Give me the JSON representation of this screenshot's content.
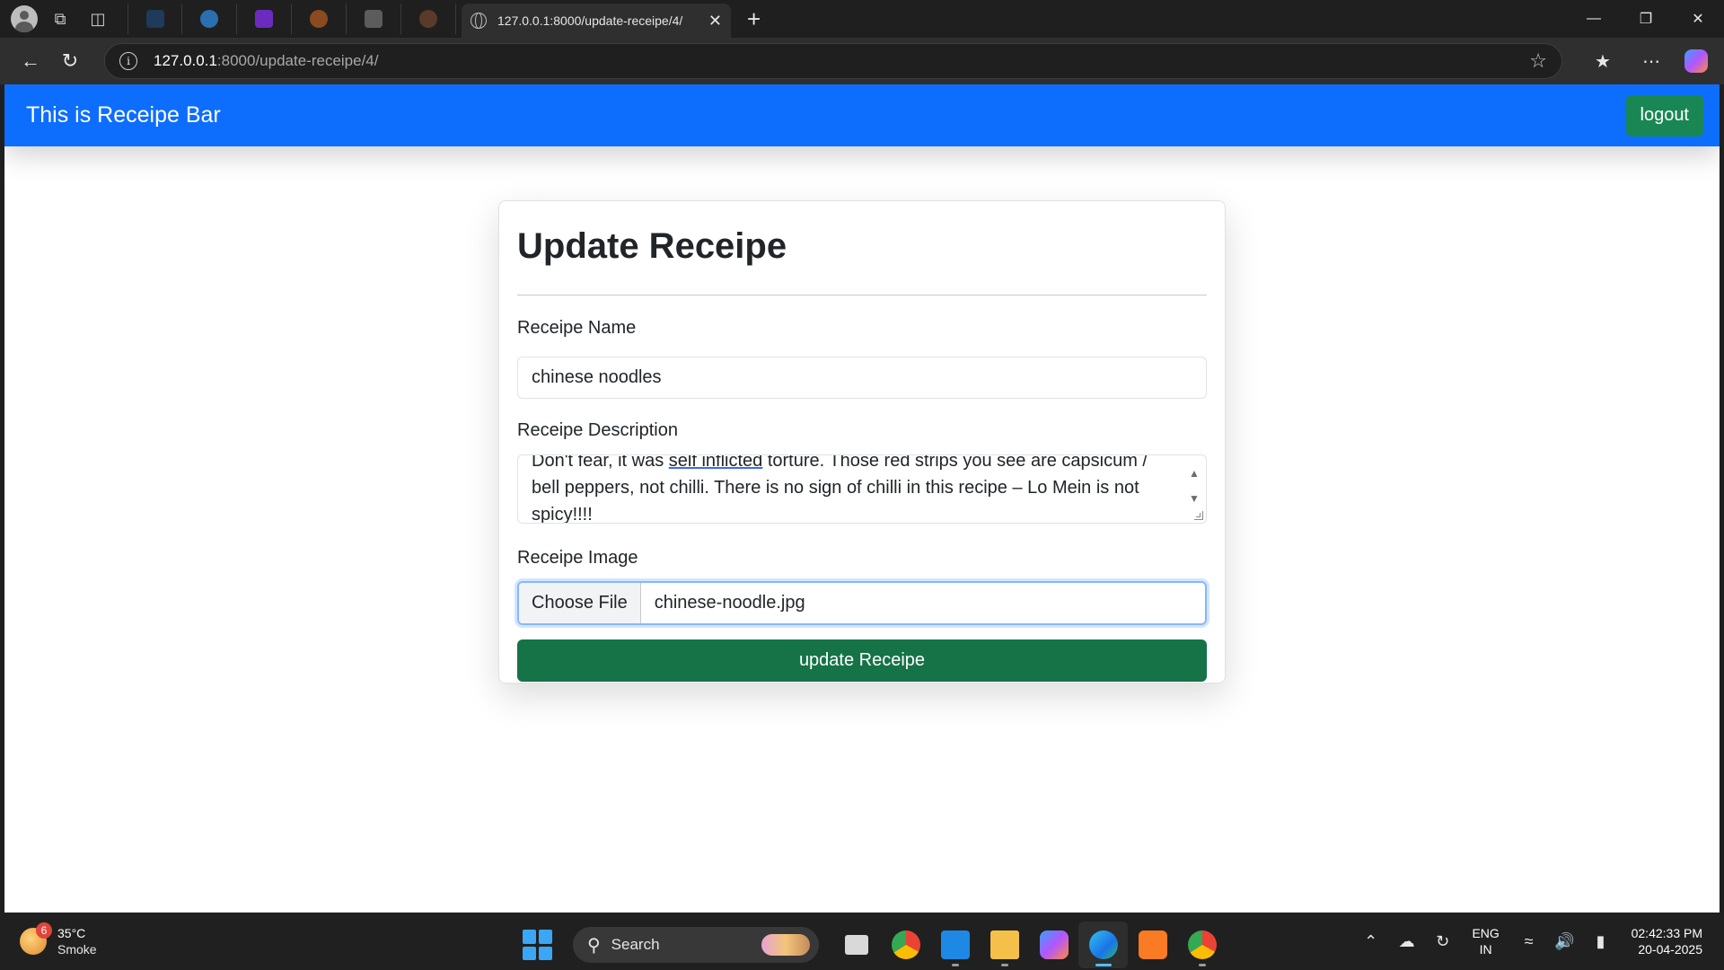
{
  "browser": {
    "tab_title": "127.0.0.1:8000/update-receipe/4/",
    "url_host": "127.0.0.1",
    "url_path": ":8000/update-receipe/4/",
    "pinned_tab_colors": [
      "#1f3a5a",
      "#2a6fb0",
      "#6b2bbf",
      "#8a4b1f",
      "#5c5c5c",
      "#5a3a2a"
    ]
  },
  "app": {
    "brand": "This is Receipe Bar",
    "logout_label": "logout"
  },
  "form": {
    "title": "Update Receipe",
    "name_label": "Receipe Name",
    "name_value": "chinese noodles",
    "description_label": "Receipe Description",
    "description_line1_start": "Don't fear, it was ",
    "description_line1_underlined": "self inflicted",
    "description_line1_end": " torture. Those red strips you see are capsicum /",
    "description_line2": "bell peppers, not chilli. There is no sign of chilli in this recipe – Lo Mein is not",
    "description_line3": "spicy!!!!",
    "image_label": "Receipe Image",
    "file_button_label": "Choose File",
    "file_name": "chinese-noodle.jpg",
    "submit_label": "update Receipe"
  },
  "taskbar": {
    "weather_badge": "6",
    "temperature": "35°C",
    "condition": "Smoke",
    "search_label": "Search",
    "lang_line1": "ENG",
    "lang_line2": "IN",
    "time": "02:42:33 PM",
    "date": "20-04-2025"
  },
  "colors": {
    "primary": "#0d6efd",
    "success": "#198754",
    "success_dark": "#157347"
  }
}
